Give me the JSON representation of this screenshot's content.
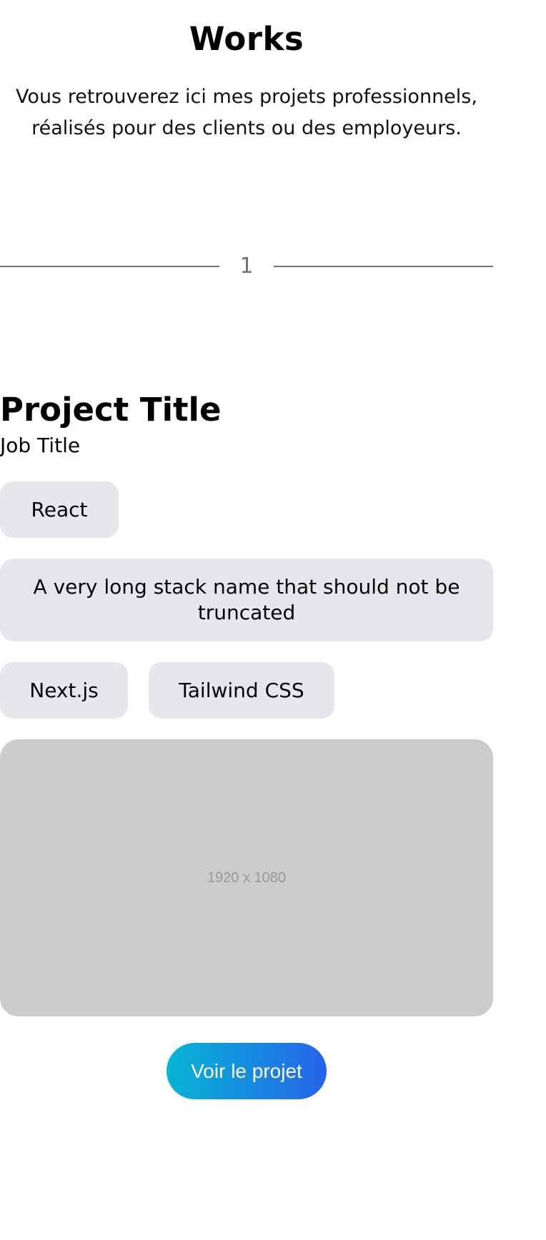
{
  "header": {
    "title": "Works",
    "intro": "Vous retrouverez ici mes projets professionnels, réalisés pour des clients ou des employeurs."
  },
  "divider": {
    "number": "1"
  },
  "project": {
    "title": "Project Title",
    "job_title": "Job Title",
    "stack": [
      "React",
      "A very long stack name that should not be truncated",
      "Next.js",
      "Tailwind CSS"
    ],
    "image_placeholder": "1920 x 1080",
    "cta_label": "Voir le projet"
  },
  "colors": {
    "tag_background": "#e5e7eb",
    "image_placeholder_background": "#cccccc",
    "divider": "#6b7280",
    "cta_gradient_start": "#06b6d4",
    "cta_gradient_end": "#2563eb"
  }
}
